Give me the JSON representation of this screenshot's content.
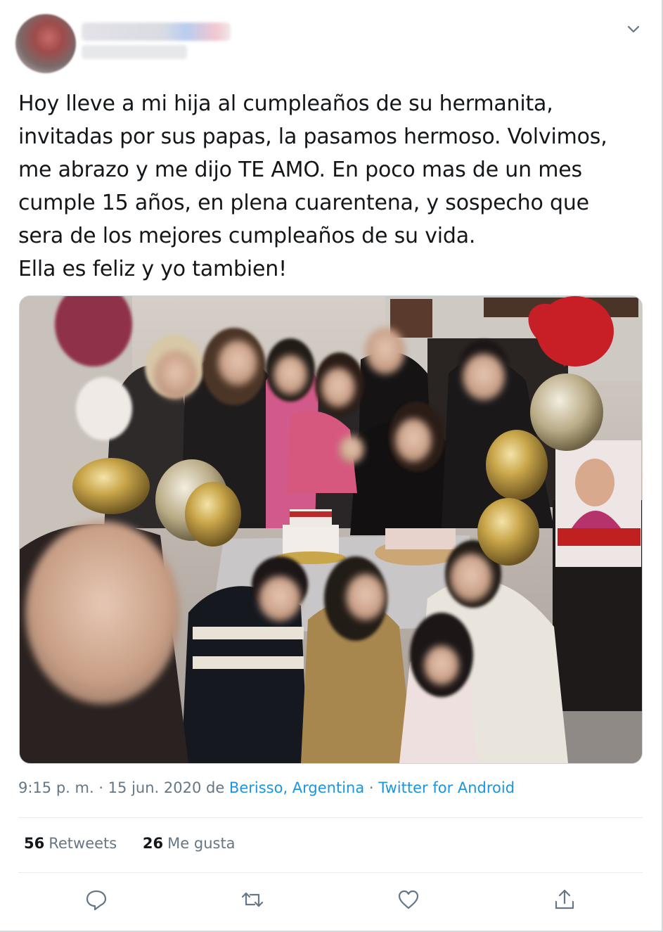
{
  "tweet": {
    "text": "Hoy lleve a mi hija al cumpleaños de su hermanita,\ninvitadas por sus papas, la pasamos hermoso. Volvimos,\nme abrazo y me dijo TE AMO. En poco mas de un mes\ncumple 15 años, en plena cuarentena, y sospecho que\nsera de los mejores cumpleaños de su vida.\nElla es feliz y yo tambien!",
    "meta_prefix": "9:15 p. m. · 15 jun. 2020 de ",
    "location": "Berisso, Argentina",
    "meta_sep": " · ",
    "source": "Twitter for Android"
  },
  "stats": {
    "retweets_count": "56",
    "retweets_label": "Retweets",
    "likes_count": "26",
    "likes_label": "Me gusta"
  },
  "colors": {
    "link": "#1b95e0",
    "meta": "#657786",
    "text": "#14171a"
  },
  "icons": {
    "menu": "chevron-down-icon",
    "reply": "reply-icon",
    "retweet": "retweet-icon",
    "like": "heart-icon",
    "share": "share-icon"
  }
}
